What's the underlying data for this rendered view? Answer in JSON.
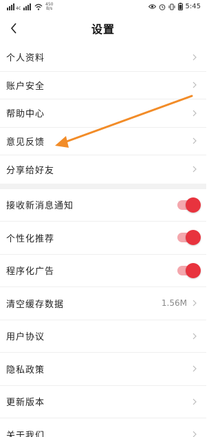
{
  "status_bar": {
    "speed_top": "450",
    "speed_bottom": "B/s",
    "time": "5:45"
  },
  "header": {
    "title": "设置"
  },
  "group1": [
    {
      "label": "个人资料"
    },
    {
      "label": "账户安全"
    },
    {
      "label": "帮助中心"
    },
    {
      "label": "意见反馈"
    },
    {
      "label": "分享给好友"
    }
  ],
  "group2": {
    "toggles": [
      {
        "label": "接收新消息通知",
        "on": true
      },
      {
        "label": "个性化推荐",
        "on": true
      },
      {
        "label": "程序化广告",
        "on": true
      }
    ],
    "cache": {
      "label": "清空缓存数据",
      "value": "1.56M"
    },
    "links": [
      {
        "label": "用户协议"
      },
      {
        "label": "隐私政策"
      },
      {
        "label": "更新版本"
      },
      {
        "label": "关于我们"
      }
    ]
  },
  "colors": {
    "accent": "#e8333e",
    "arrow": "#f28c28"
  }
}
